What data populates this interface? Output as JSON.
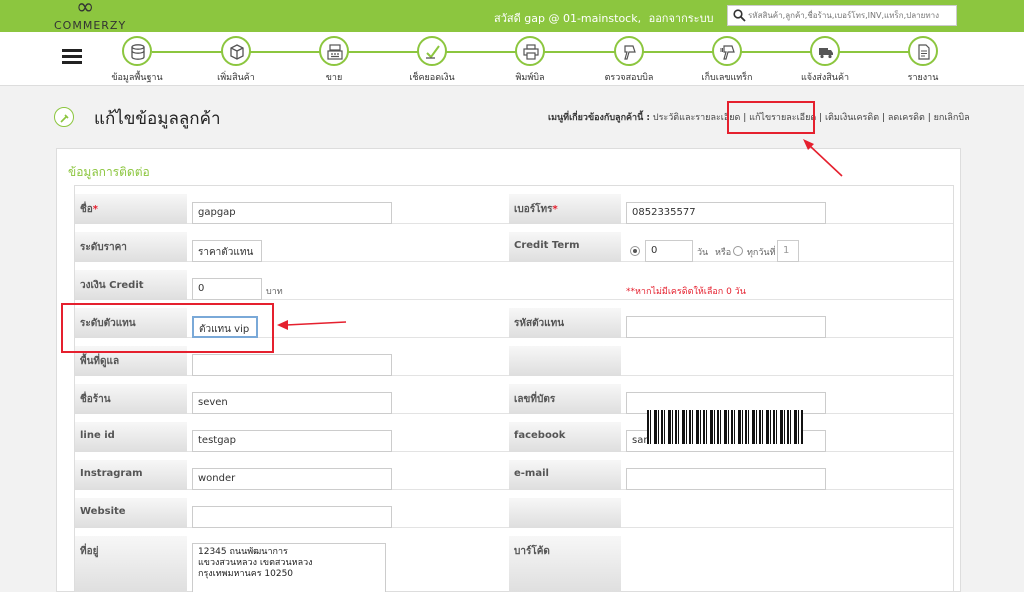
{
  "brand": {
    "logo_text": "COMMERZY"
  },
  "header": {
    "greeting": "สวัสดี gap @ 01-mainstock,",
    "logout": "ออกจากระบบ",
    "search_placeholder": "รหัสสินค้า,ลูกค้า,ชื่อร้าน,เบอร์โทร,INV,แทร็ก,ปลายทาง",
    "accent_color": "#8cc63f"
  },
  "nav": [
    {
      "label": "ข้อมูลพื้นฐาน",
      "icon": "database-icon"
    },
    {
      "label": "เพิ่มสินค้า",
      "icon": "box-icon"
    },
    {
      "label": "ขาย",
      "icon": "cash-register-icon"
    },
    {
      "label": "เช็คยอดเงิน",
      "icon": "money-check-icon"
    },
    {
      "label": "พิมพ์บิล",
      "icon": "printer-icon"
    },
    {
      "label": "ตรวจสอบบิล",
      "icon": "scanner-icon"
    },
    {
      "label": "เก็บเลขแทร็ก",
      "icon": "barcode-scanner-icon"
    },
    {
      "label": "แจ้งส่งสินค้า",
      "icon": "truck-icon"
    },
    {
      "label": "รายงาน",
      "icon": "report-icon"
    }
  ],
  "page": {
    "title": "แก้ไขข้อมูลลูกค้า",
    "related_label": "เมนูที่เกี่ยวข้องกับลูกค้านี้ :",
    "related_links": [
      "ประวัติและรายละเอียด",
      "แก้ไขรายละเอียด",
      "เติมเงินเครดิต",
      "ลดเครดิต",
      "ยกเลิกบิล"
    ]
  },
  "form": {
    "section_title": "ข้อมูลการติดต่อ",
    "name_label": "ชื่อ",
    "name_value": "gapgap",
    "phone_label": "เบอร์โทร",
    "phone_value": "0852335577",
    "price_level_label": "ระดับราคา",
    "price_level_value": "ราคาตัวแทน",
    "credit_term_label": "Credit Term",
    "credit_term_days": "0",
    "credit_term_unit": "วัน",
    "credit_term_or": "หรือ",
    "credit_term_every": "ทุกวันที่",
    "credit_term_every_value": "1",
    "credit_limit_label": "วงเงิน Credit",
    "credit_limit_value": "0",
    "credit_limit_unit": "บาท",
    "credit_note": "**หากไม่มีเครดิตให้เลือก 0 วัน",
    "agent_level_label": "ระดับตัวแทน",
    "agent_level_value": "ตัวแทน vip",
    "agent_code_label": "รหัสตัวแทน",
    "agent_code_value": "",
    "area_label": "พื้นที่ดูแล",
    "area_value": "",
    "shop_label": "ชื่อร้าน",
    "shop_value": "seven",
    "id_card_label": "เลขที่บัตร",
    "id_card_value": "",
    "line_label": "line id",
    "line_value": "testgap",
    "facebook_label": "facebook",
    "facebook_value": "sanook",
    "instagram_label": "Instragram",
    "instagram_value": "wonder",
    "email_label": "e-mail",
    "email_value": "",
    "website_label": "Website",
    "website_value": "",
    "address_label": "ที่อยู่",
    "address_value": "12345 ถนนพัฒนาการ\nแขวงสวนหลวง เขตสวนหลวง\nกรุงเทพมหานคร 10250",
    "barcode_label": "บาร์โค้ด"
  }
}
